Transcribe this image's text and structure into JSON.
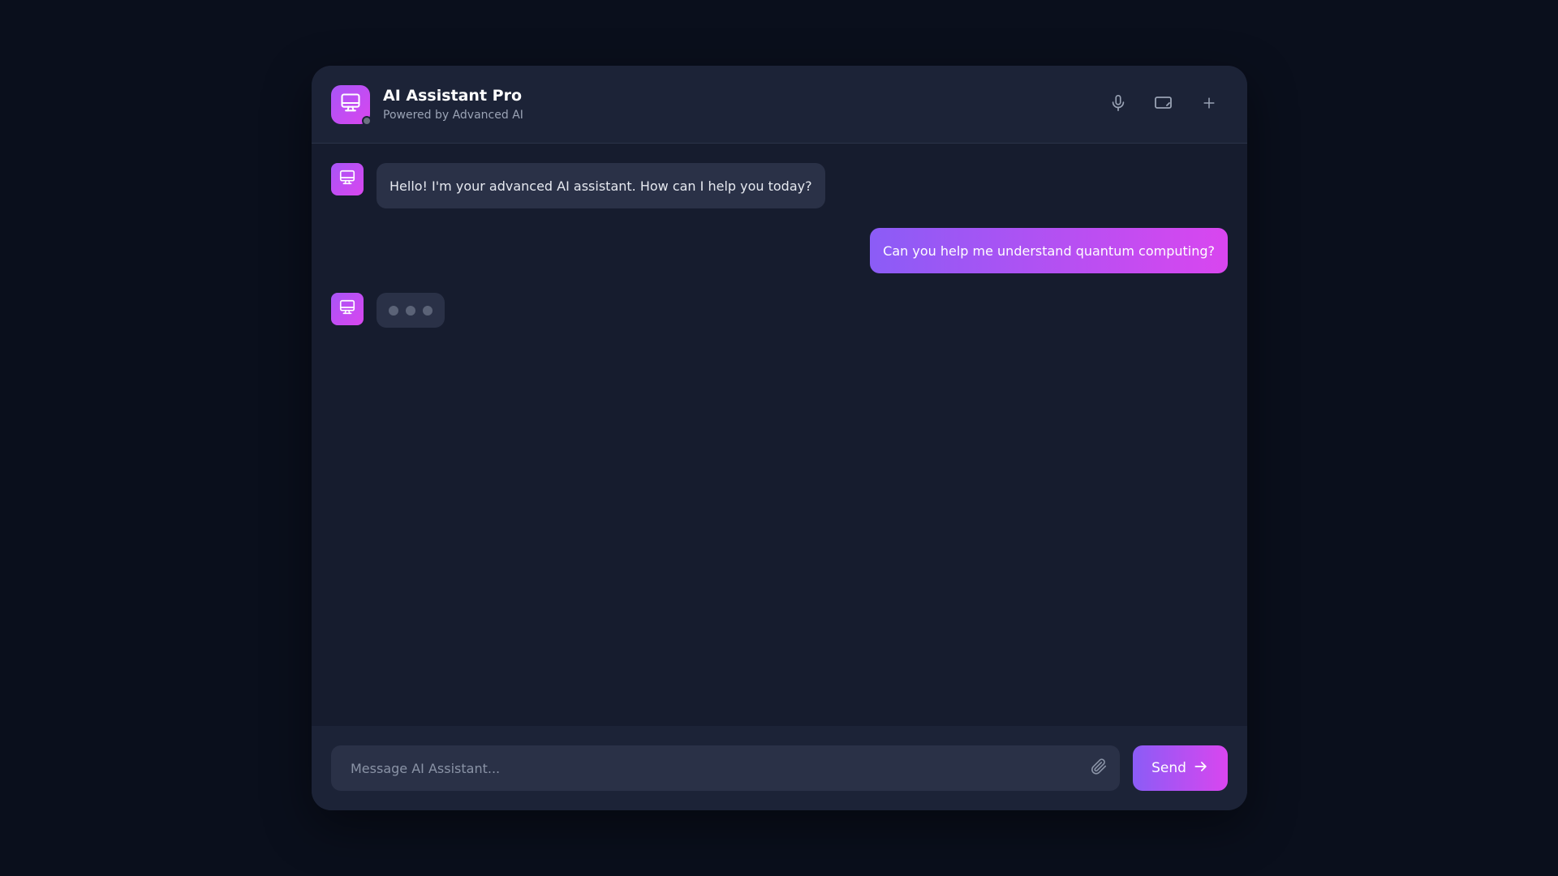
{
  "header": {
    "title": "AI Assistant Pro",
    "subtitle": "Powered by Advanced AI",
    "avatar_icon": "monitor-icon",
    "status": "offline",
    "actions": [
      {
        "icon": "microphone-icon"
      },
      {
        "icon": "screen-share-icon"
      },
      {
        "icon": "plus-icon"
      }
    ]
  },
  "messages": [
    {
      "role": "assistant",
      "text": "Hello! I'm your advanced AI assistant. How can I help you today?"
    },
    {
      "role": "user",
      "text": "Can you help me understand quantum computing?"
    },
    {
      "role": "assistant",
      "typing": true
    }
  ],
  "composer": {
    "placeholder": "Message AI Assistant...",
    "value": "",
    "attach_icon": "paperclip-icon",
    "send_label": "Send",
    "send_icon": "arrow-right-icon"
  },
  "colors": {
    "accent_start": "#8b5cf6",
    "accent_end": "#d946ef",
    "background": "#0a0f1c",
    "panel": "#161c2e",
    "bubble": "#2a3147"
  }
}
